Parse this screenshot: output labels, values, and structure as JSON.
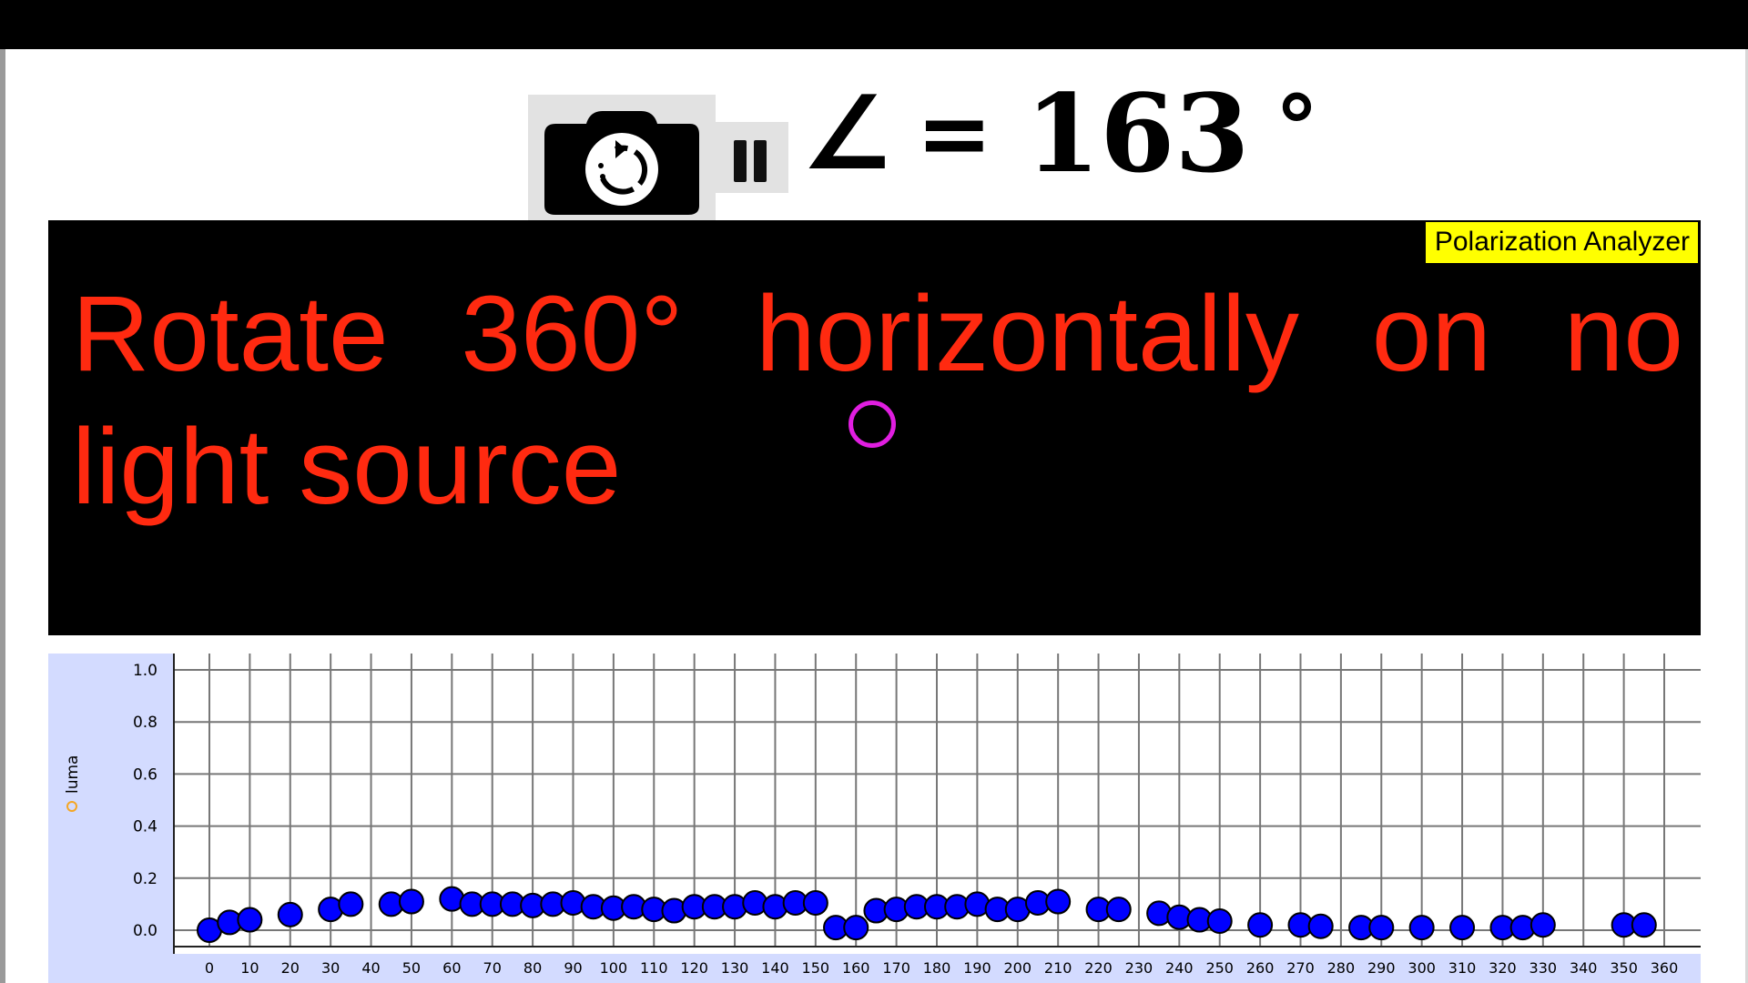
{
  "toolbar": {
    "camera_icon": "camera-rotate-icon",
    "pause_icon": "pause-icon"
  },
  "readout": {
    "symbol": "∠",
    "equals": "=",
    "value": "163",
    "unit": "°"
  },
  "panel": {
    "badge": "Polarization Analyzer",
    "instruction": "Rotate 360° horizontally on no light source",
    "background": "#000000",
    "instruction_color": "#ff2a10",
    "badge_color": "#ffff00"
  },
  "chart_data": {
    "type": "scatter",
    "ylabel": "luma",
    "ylabel_icon": "sun-icon",
    "xlim": [
      0,
      360
    ],
    "ylim": [
      0,
      1
    ],
    "xticks": [
      0,
      10,
      20,
      30,
      40,
      50,
      60,
      70,
      80,
      90,
      100,
      110,
      120,
      130,
      140,
      150,
      160,
      170,
      180,
      190,
      200,
      210,
      220,
      230,
      240,
      250,
      260,
      270,
      280,
      290,
      300,
      310,
      320,
      330,
      340,
      350,
      360
    ],
    "yticks": [
      "0.0",
      "0.8",
      "0.6",
      "0.4",
      "0.2",
      "1.0"
    ],
    "yticks_values": [
      0,
      0.8,
      0.6,
      0.4,
      0.2,
      1.0
    ],
    "grid": true,
    "marker_color": "#0000ff",
    "background": "#d3dbff",
    "x": [
      0,
      5,
      10,
      20,
      30,
      35,
      45,
      50,
      60,
      65,
      70,
      75,
      80,
      85,
      90,
      95,
      100,
      105,
      110,
      115,
      120,
      125,
      130,
      135,
      140,
      145,
      150,
      155,
      160,
      165,
      170,
      175,
      180,
      185,
      190,
      195,
      200,
      205,
      210,
      220,
      225,
      235,
      240,
      245,
      250,
      260,
      270,
      275,
      285,
      290,
      300,
      310,
      320,
      325,
      330,
      350,
      355
    ],
    "y": [
      0.0,
      0.03,
      0.04,
      0.06,
      0.08,
      0.1,
      0.1,
      0.11,
      0.12,
      0.1,
      0.1,
      0.1,
      0.095,
      0.1,
      0.105,
      0.09,
      0.085,
      0.09,
      0.08,
      0.075,
      0.09,
      0.09,
      0.09,
      0.105,
      0.09,
      0.105,
      0.105,
      0.01,
      0.01,
      0.075,
      0.08,
      0.09,
      0.09,
      0.09,
      0.1,
      0.08,
      0.08,
      0.105,
      0.11,
      0.08,
      0.08,
      0.065,
      0.05,
      0.04,
      0.035,
      0.02,
      0.02,
      0.015,
      0.01,
      0.01,
      0.01,
      0.01,
      0.01,
      0.01,
      0.02,
      0.02,
      0.02
    ]
  }
}
